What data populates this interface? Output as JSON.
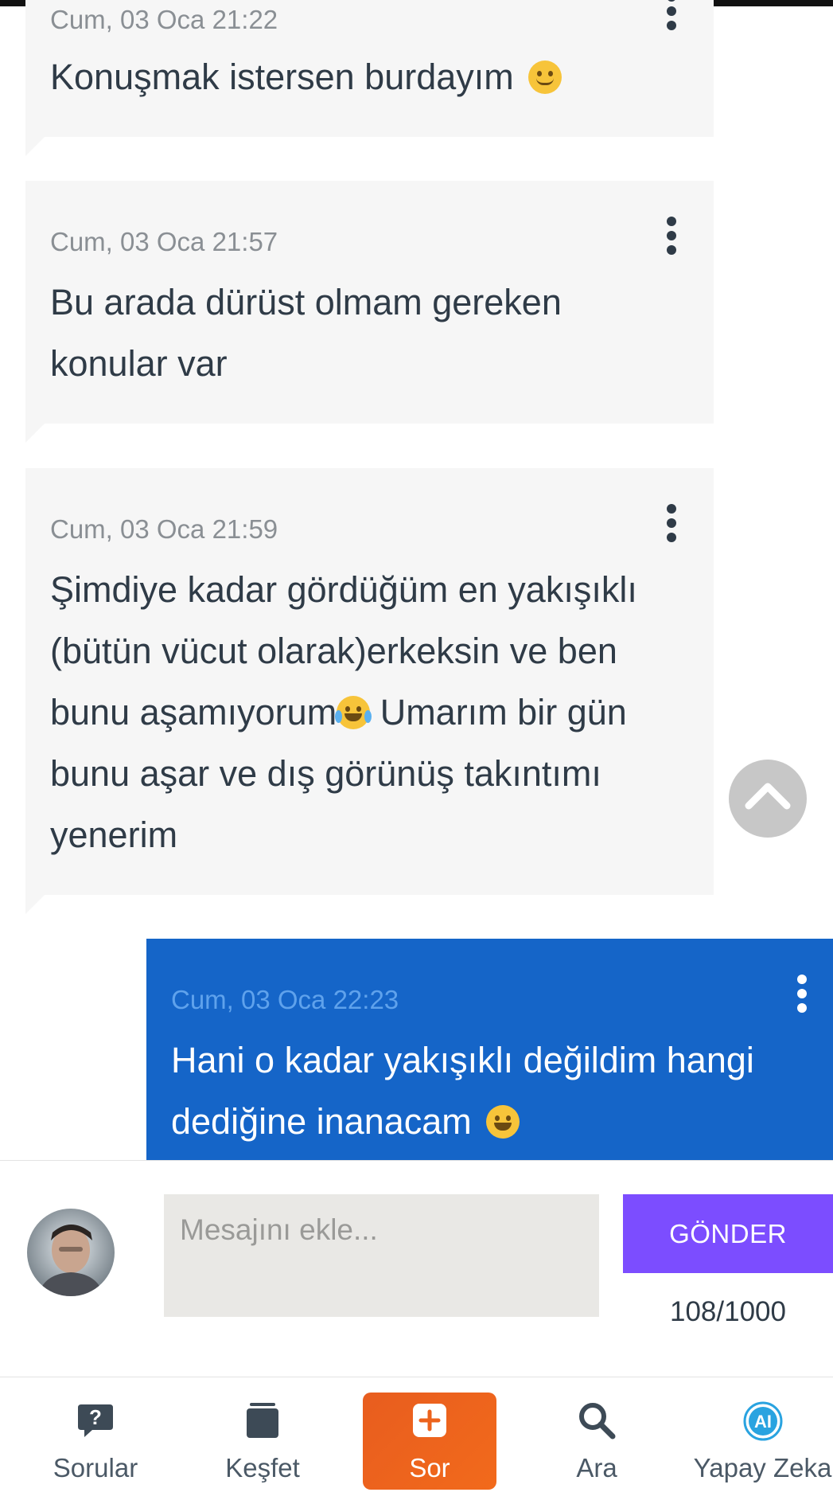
{
  "messages": [
    {
      "time": "Cum, 03 Oca 21:22",
      "text": "Konuşmak istersen burdayım",
      "emoji": "smiling-face"
    },
    {
      "time": "Cum, 03 Oca 21:57",
      "text": "Bu arada dürüst olmam gereken\nkonular var"
    },
    {
      "time": "Cum, 03 Oca 21:59",
      "text_part1": "Şimdiye kadar gördüğüm en yakışıklı\n(bütün vücut olarak)erkeksin ve ben\nbunu aşamıyorum",
      "emoji": "tears-of-joy",
      "text_part2": " Umarım bir gün\nbunu aşar ve dış görünüş takıntımı\nyenerim"
    },
    {
      "time": "Cum, 03 Oca 22:23",
      "text": "Hani o kadar yakışıklı değildim hangi\ndediğine inanacam",
      "emoji": "grinning-face",
      "mine": true
    }
  ],
  "composer": {
    "placeholder": "Mesajını ekle...",
    "send_label": "GÖNDER",
    "counter": "108/1000"
  },
  "nav": {
    "sorular": "Sorular",
    "kesfet": "Keşfet",
    "sor": "Sor",
    "ara": "Ara",
    "yapay_zeka": "Yapay Zeka",
    "ai_badge": "AI"
  },
  "colors": {
    "bubble_incoming": "#f6f6f6",
    "bubble_mine": "#1565c8",
    "send_button": "#7c4dff",
    "ask_button": "#f26a1b"
  }
}
